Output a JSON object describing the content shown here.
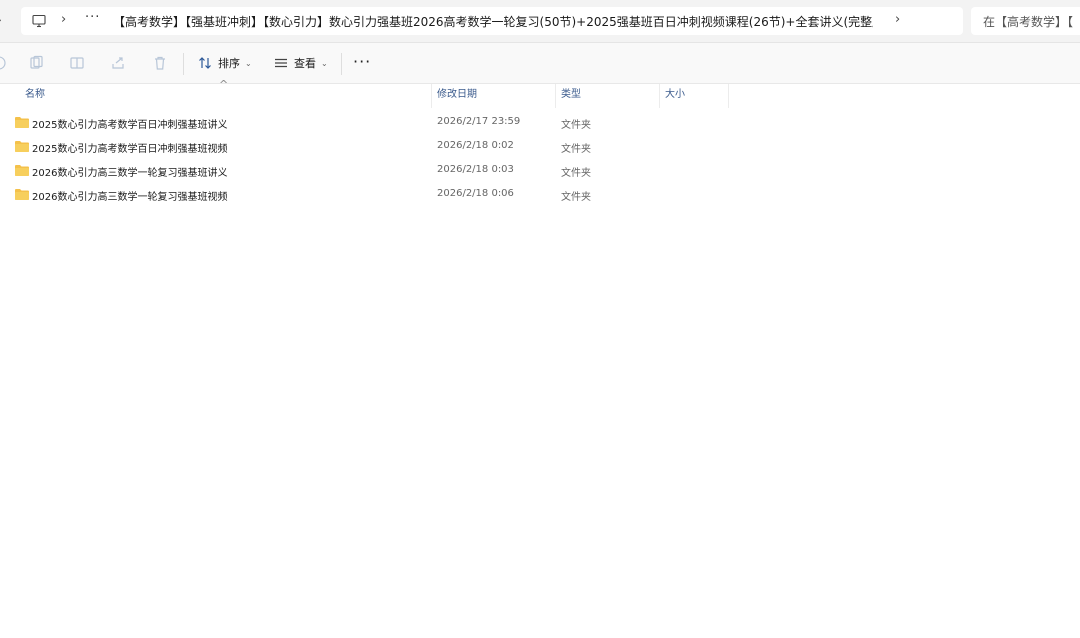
{
  "address_bar": {
    "breadcrumb_ellipsis": "···",
    "path": "【高考数学】【强基班冲刺】【数心引力】数心引力强基班2026高考数学一轮复习(50节)+2025强基班百日冲刺视频课程(26节)+全套讲义(完整版)",
    "search_placeholder": "在【高考数学】【"
  },
  "toolbar": {
    "sort_label": "排序",
    "view_label": "查看",
    "more_label": "···"
  },
  "columns": {
    "name": "名称",
    "date": "修改日期",
    "type": "类型",
    "size": "大小"
  },
  "rows": [
    {
      "name": "2025数心引力高考数学百日冲刺强基班讲义",
      "date": "2026/2/17 23:59",
      "type": "文件夹"
    },
    {
      "name": "2025数心引力高考数学百日冲刺强基班视频",
      "date": "2026/2/18 0:02",
      "type": "文件夹"
    },
    {
      "name": "2026数心引力高三数学一轮复习强基班讲义",
      "date": "2026/2/18 0:03",
      "type": "文件夹"
    },
    {
      "name": "2026数心引力高三数学一轮复习强基班视频",
      "date": "2026/2/18 0:06",
      "type": "文件夹"
    }
  ],
  "colors": {
    "folder": "#f4c14b",
    "header_text": "#3a5a8c",
    "toolbar_bg": "#f9f9f9",
    "address_bg": "#f3f3f3"
  }
}
